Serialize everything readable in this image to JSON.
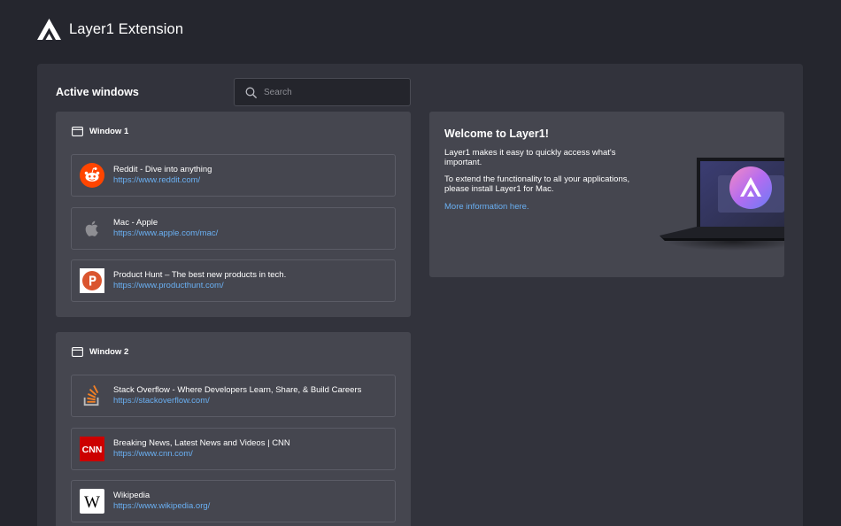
{
  "app": {
    "title": "Layer1 Extension"
  },
  "main": {
    "section_title": "Active windows",
    "search": {
      "placeholder": "Search",
      "value": ""
    }
  },
  "windows": [
    {
      "label": "Window 1",
      "tabs": [
        {
          "title": "Reddit - Dive into anything",
          "url": "https://www.reddit.com/",
          "icon": "reddit-icon"
        },
        {
          "title": "Mac - Apple",
          "url": "https://www.apple.com/mac/",
          "icon": "apple-icon"
        },
        {
          "title": "Product Hunt – The best new products in tech.",
          "url": "https://www.producthunt.com/",
          "icon": "producthunt-icon"
        }
      ]
    },
    {
      "label": "Window 2",
      "tabs": [
        {
          "title": "Stack Overflow - Where Developers Learn, Share, & Build Careers",
          "url": "https://stackoverflow.com/",
          "icon": "stackoverflow-icon"
        },
        {
          "title": "Breaking News, Latest News and Videos | CNN",
          "url": "https://www.cnn.com/",
          "icon": "cnn-icon"
        },
        {
          "title": "Wikipedia",
          "url": "https://www.wikipedia.org/",
          "icon": "wikipedia-icon"
        }
      ]
    }
  ],
  "welcome": {
    "title": "Welcome to Layer1!",
    "paragraph1": "Layer1 makes it easy to quickly access what's important.",
    "paragraph2": "To extend the functionality to all your applications, please install Layer1 for Mac.",
    "link": "More information here."
  },
  "colors": {
    "background": "#25262e",
    "panel": "#32333c",
    "card": "#45464f",
    "link": "#6ab0f3",
    "reddit": "#ff4500",
    "producthunt": "#da552f",
    "stackoverflow": "#f48024",
    "cnn": "#cc0000"
  }
}
